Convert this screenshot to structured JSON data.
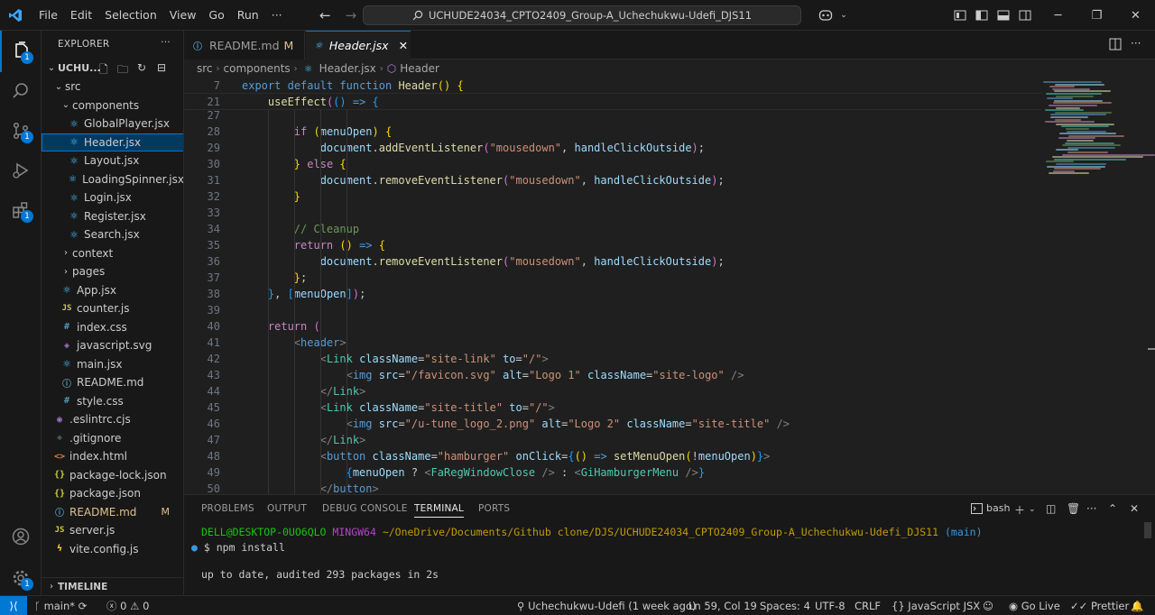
{
  "menu": [
    "File",
    "Edit",
    "Selection",
    "View",
    "Go",
    "Run",
    "···"
  ],
  "command_center": "UCHUDE24034_CPTO2409_Group-A_Uchechukwu-Udefi_DJS11",
  "explorer": {
    "title": "EXPLORER",
    "root": "UCHU...",
    "rows": [
      {
        "label": "src",
        "indent": 1,
        "chev": "⌄",
        "icon": ""
      },
      {
        "label": "components",
        "indent": 2,
        "chev": "⌄",
        "icon": ""
      },
      {
        "label": "GlobalPlayer.jsx",
        "indent": 3,
        "icon": "react"
      },
      {
        "label": "Header.jsx",
        "indent": 3,
        "icon": "react",
        "selected": true
      },
      {
        "label": "Layout.jsx",
        "indent": 3,
        "icon": "react"
      },
      {
        "label": "LoadingSpinner.jsx",
        "indent": 3,
        "icon": "react"
      },
      {
        "label": "Login.jsx",
        "indent": 3,
        "icon": "react"
      },
      {
        "label": "Register.jsx",
        "indent": 3,
        "icon": "react"
      },
      {
        "label": "Search.jsx",
        "indent": 3,
        "icon": "react"
      },
      {
        "label": "context",
        "indent": 2,
        "chev": "›",
        "icon": ""
      },
      {
        "label": "pages",
        "indent": 2,
        "chev": "›",
        "icon": ""
      },
      {
        "label": "App.jsx",
        "indent": 2,
        "icon": "react"
      },
      {
        "label": "counter.js",
        "indent": 2,
        "icon": "js"
      },
      {
        "label": "index.css",
        "indent": 2,
        "icon": "css"
      },
      {
        "label": "javascript.svg",
        "indent": 2,
        "icon": "svg"
      },
      {
        "label": "main.jsx",
        "indent": 2,
        "icon": "react"
      },
      {
        "label": "README.md",
        "indent": 2,
        "icon": "md"
      },
      {
        "label": "style.css",
        "indent": 2,
        "icon": "css"
      },
      {
        "label": ".eslintrc.cjs",
        "indent": 1,
        "icon": "eslint"
      },
      {
        "label": ".gitignore",
        "indent": 1,
        "icon": "git"
      },
      {
        "label": "index.html",
        "indent": 1,
        "icon": "html"
      },
      {
        "label": "package-lock.json",
        "indent": 1,
        "icon": "json"
      },
      {
        "label": "package.json",
        "indent": 1,
        "icon": "json"
      },
      {
        "label": "README.md",
        "indent": 1,
        "icon": "md",
        "mod": "M"
      },
      {
        "label": "server.js",
        "indent": 1,
        "icon": "js"
      },
      {
        "label": "vite.config.js",
        "indent": 1,
        "icon": "vite"
      }
    ],
    "timeline": "TIMELINE"
  },
  "tabs": [
    {
      "label": "README.md",
      "mod": "M"
    },
    {
      "label": "Header.jsx"
    }
  ],
  "breadcrumb": [
    "src",
    "components",
    "Header.jsx",
    "Header"
  ],
  "sticky": [
    {
      "ln": "7",
      "html": "<span class='k'>export</span> <span class='k'>default</span> <span class='k'>function</span> <span class='f'>Header</span><span class='y'>()</span> <span class='y'>{</span>"
    },
    {
      "ln": "21",
      "html": "    <span class='f'>useEffect</span><span class='br2'>(</span><span class='br3'>()</span> <span class='k'>=></span> <span class='br3'>{</span>"
    }
  ],
  "code": [
    {
      "ln": "27",
      "html": ""
    },
    {
      "ln": "28",
      "html": "        <span class='c'>if</span> <span class='y'>(</span><span class='v'>menuOpen</span><span class='y'>)</span> <span class='y'>{</span>"
    },
    {
      "ln": "29",
      "html": "            <span class='v'>document</span>.<span class='f'>addEventListener</span><span class='br2'>(</span><span class='s'>\"mousedown\"</span>, <span class='v'>handleClickOutside</span><span class='br2'>)</span>;"
    },
    {
      "ln": "30",
      "html": "        <span class='y'>}</span> <span class='c'>else</span> <span class='y'>{</span>"
    },
    {
      "ln": "31",
      "html": "            <span class='v'>document</span>.<span class='f'>removeEventListener</span><span class='br2'>(</span><span class='s'>\"mousedown\"</span>, <span class='v'>handleClickOutside</span><span class='br2'>)</span>;"
    },
    {
      "ln": "32",
      "html": "        <span class='y'>}</span>"
    },
    {
      "ln": "33",
      "html": ""
    },
    {
      "ln": "34",
      "html": "        <span class='g'>// Cleanup</span>"
    },
    {
      "ln": "35",
      "html": "        <span class='c'>return</span> <span class='y'>()</span> <span class='k'>=></span> <span class='y'>{</span>"
    },
    {
      "ln": "36",
      "html": "            <span class='v'>document</span>.<span class='f'>removeEventListener</span><span class='br2'>(</span><span class='s'>\"mousedown\"</span>, <span class='v'>handleClickOutside</span><span class='br2'>)</span>;"
    },
    {
      "ln": "37",
      "html": "        <span class='y'>}</span>;"
    },
    {
      "ln": "38",
      "html": "    <span class='br3'>}</span>, <span class='br3'>[</span><span class='v'>menuOpen</span><span class='br3'>]</span><span class='br2'>)</span>;"
    },
    {
      "ln": "39",
      "html": ""
    },
    {
      "ln": "40",
      "html": "    <span class='c'>return</span> <span class='br2'>(</span>"
    },
    {
      "ln": "41",
      "html": "        <span class='p'>&lt;</span><span class='k'>header</span><span class='p'>&gt;</span>"
    },
    {
      "ln": "42",
      "html": "            <span class='p'>&lt;</span><span class='t'>Link</span> <span class='v'>className</span>=<span class='s'>\"site-link\"</span> <span class='v'>to</span>=<span class='s'>\"/\"</span><span class='p'>&gt;</span>"
    },
    {
      "ln": "43",
      "html": "                <span class='p'>&lt;</span><span class='k'>img</span> <span class='v'>src</span>=<span class='s'>\"/favicon.svg\"</span> <span class='v'>alt</span>=<span class='s'>\"Logo 1\"</span> <span class='v'>className</span>=<span class='s'>\"site-logo\"</span> <span class='p'>/&gt;</span>"
    },
    {
      "ln": "44",
      "html": "            <span class='p'>&lt;/</span><span class='t'>Link</span><span class='p'>&gt;</span>"
    },
    {
      "ln": "45",
      "html": "            <span class='p'>&lt;</span><span class='t'>Link</span> <span class='v'>className</span>=<span class='s'>\"site-title\"</span> <span class='v'>to</span>=<span class='s'>\"/\"</span><span class='p'>&gt;</span>"
    },
    {
      "ln": "46",
      "html": "                <span class='p'>&lt;</span><span class='k'>img</span> <span class='v'>src</span>=<span class='s'>\"/u-tune_logo_2.png\"</span> <span class='v'>alt</span>=<span class='s'>\"Logo 2\"</span> <span class='v'>className</span>=<span class='s'>\"site-title\"</span> <span class='p'>/&gt;</span>"
    },
    {
      "ln": "47",
      "html": "            <span class='p'>&lt;/</span><span class='t'>Link</span><span class='p'>&gt;</span>"
    },
    {
      "ln": "48",
      "html": "            <span class='p'>&lt;</span><span class='k'>button</span> <span class='v'>className</span>=<span class='s'>\"hamburger\"</span> <span class='v'>onClick</span>=<span class='br3'>{</span><span class='y'>()</span> <span class='k'>=></span> <span class='f'>setMenuOpen</span><span class='y'>(</span>!<span class='v'>menuOpen</span><span class='y'>)</span><span class='br3'>}</span><span class='p'>&gt;</span>"
    },
    {
      "ln": "49",
      "html": "                <span class='br3'>{</span><span class='v'>menuOpen</span> ? <span class='p'>&lt;</span><span class='t'>FaRegWindowClose</span> <span class='p'>/&gt;</span> : <span class='p'>&lt;</span><span class='t'>GiHamburgerMenu</span> <span class='p'>/&gt;</span><span class='br3'>}</span>"
    },
    {
      "ln": "50",
      "html": "            <span class='p'>&lt;/</span><span class='k'>button</span><span class='p'>&gt;</span>"
    }
  ],
  "panel": {
    "tabs": [
      "PROBLEMS",
      "OUTPUT",
      "DEBUG CONSOLE",
      "TERMINAL",
      "PORTS"
    ],
    "shell": "bash",
    "prompt_user": "DELL@DESKTOP-0UO6QLO",
    "prompt_env": "MINGW64",
    "prompt_path": "~/OneDrive/Documents/Github clone/DJS/UCHUDE24034_CPTO2409_Group-A_Uchechukwu-Udefi_DJS11",
    "prompt_branch": "(main)",
    "command": "$ npm install",
    "output": "up to date, audited 293 packages in 2s"
  },
  "status": {
    "branch": "main*",
    "errors": "0",
    "warnings": "0",
    "blame": "Uchechukwu-Udefi (1 week ago)",
    "position": "Ln 59, Col 19",
    "spaces": "Spaces: 4",
    "encoding": "UTF-8",
    "eol": "CRLF",
    "language": "JavaScript JSX",
    "golive": "Go Live",
    "prettier": "Prettier"
  },
  "colors": {
    "accent": "#0078d4",
    "background": "#1f1f1f",
    "chrome": "#181818"
  }
}
